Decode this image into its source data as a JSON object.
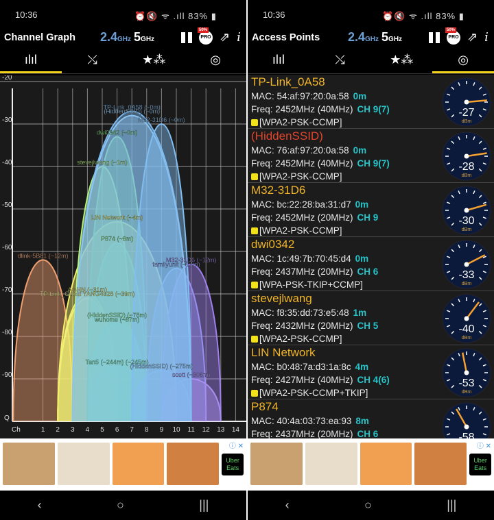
{
  "status": {
    "time": "10:36",
    "icons": "⏰🔇 ᯤ .ıll",
    "battery": "83%"
  },
  "bands": {
    "b24": "2.4",
    "b5": "5",
    "unit": "GHz"
  },
  "pro_badge": "PRO",
  "pro_tag": "50%",
  "tabs": [
    {
      "icon": "bar-chart-icon",
      "glyph": "ılıl"
    },
    {
      "icon": "time-graph-icon",
      "glyph": "⤯"
    },
    {
      "icon": "rating-stars-icon",
      "glyph": "★⁂"
    },
    {
      "icon": "access-point-icon",
      "glyph": "◎"
    }
  ],
  "left": {
    "title": "Channel Graph",
    "active_tab": 0
  },
  "right": {
    "title": "Access Points",
    "active_tab": 3
  },
  "chart_data": {
    "type": "area",
    "ylabel_bottom": "Q",
    "xlabel": "Ch",
    "ylim": [
      -100,
      -20
    ],
    "yticks": [
      -20,
      -30,
      -40,
      -50,
      -60,
      -70,
      -80,
      -90
    ],
    "xticks": [
      1,
      2,
      3,
      4,
      5,
      6,
      7,
      8,
      9,
      10,
      11,
      12,
      13,
      14
    ],
    "grid": true,
    "series": [
      {
        "name": "dlink-5B81 (~12m)",
        "channel": 1,
        "width_mhz": 20,
        "dbm": -62,
        "color": "#f0a070"
      },
      {
        "name": "AGHN (~31m)",
        "channel": 4,
        "width_mhz": 20,
        "dbm": -70,
        "color": "#f5f07a"
      },
      {
        "name": "TP-Link_Guest YANG4928 (~39m)",
        "channel": 4,
        "width_mhz": 20,
        "dbm": -71,
        "color": "#e8f080"
      },
      {
        "name": "LIN Network (~4m)",
        "channel": 6,
        "width_mhz": 40,
        "dbm": -53,
        "color": "#f3f06a"
      },
      {
        "name": "stevejlwang (~1m)",
        "channel": 5,
        "width_mhz": 20,
        "dbm": -40,
        "color": "#b4f07a"
      },
      {
        "name": "P874 (~8m)",
        "channel": 6,
        "width_mhz": 20,
        "dbm": -58,
        "color": "#8af08a"
      },
      {
        "name": "(HiddenSSID) (~78m)",
        "channel": 6,
        "width_mhz": 20,
        "dbm": -76,
        "color": "#90f0a0"
      },
      {
        "name": "wuhome (~87m)",
        "channel": 6,
        "width_mhz": 20,
        "dbm": -77,
        "color": "#80f0a8"
      },
      {
        "name": "Tan5 (~244m) (~245m)",
        "channel": 6,
        "width_mhz": 20,
        "dbm": -87,
        "color": "#80f0c0"
      },
      {
        "name": "dwi0342 (~0m)",
        "channel": 6,
        "width_mhz": 20,
        "dbm": -33,
        "color": "#7ae07a"
      },
      {
        "name": "(HiddenSSID) (~275m)",
        "channel": 9,
        "width_mhz": 20,
        "dbm": -88,
        "color": "#90c8f0"
      },
      {
        "name": "familyunit (~14m)",
        "channel": 10,
        "width_mhz": 20,
        "dbm": -64,
        "color": "#8c9cf0"
      },
      {
        "name": "M32-31D6 (~12m)",
        "channel": 11,
        "width_mhz": 20,
        "dbm": -63,
        "color": "#a080f0"
      },
      {
        "name": "scott (~306m)",
        "channel": 11,
        "width_mhz": 20,
        "dbm": -90,
        "color": "#a890f0"
      },
      {
        "name": "TP-Link_0A58 (~0m)",
        "channel": 7,
        "width_mhz": 40,
        "dbm": -27,
        "color": "#7ab8f0"
      },
      {
        "name": "(HiddenSSID) (~0m)",
        "channel": 7,
        "width_mhz": 40,
        "dbm": -28,
        "color": "#8cc4f0"
      },
      {
        "name": "M32-31D6 (~0m)",
        "channel": 9,
        "width_mhz": 20,
        "dbm": -30,
        "color": "#80bdf0"
      }
    ]
  },
  "access_points": [
    {
      "ssid": "TP-Link_0A58",
      "hidden": false,
      "mac": "MAC: 54:af:97:20:0a:58",
      "dist": "0m",
      "freq": "Freq: 2452MHz  (40MHz)",
      "ch": "CH 9(7)",
      "sec": "[WPA2-PSK-CCMP]",
      "dbm": -27
    },
    {
      "ssid": "(HiddenSSID)",
      "hidden": true,
      "mac": "MAC: 76:af:97:20:0a:58",
      "dist": "0m",
      "freq": "Freq: 2452MHz  (40MHz)",
      "ch": "CH 9(7)",
      "sec": "[WPA2-PSK-CCMP]",
      "dbm": -28
    },
    {
      "ssid": "M32-31D6",
      "hidden": false,
      "mac": "MAC: bc:22:28:ba:31:d7",
      "dist": "0m",
      "freq": "Freq: 2452MHz  (20MHz)",
      "ch": "CH 9",
      "sec": "[WPA2-PSK-CCMP]",
      "dbm": -30
    },
    {
      "ssid": "dwi0342",
      "hidden": false,
      "mac": "MAC: 1c:49:7b:70:45:d4",
      "dist": "0m",
      "freq": "Freq: 2437MHz  (20MHz)",
      "ch": "CH 6",
      "sec": "[WPA-PSK-TKIP+CCMP]",
      "dbm": -33
    },
    {
      "ssid": "stevejlwang",
      "hidden": false,
      "mac": "MAC: f8:35:dd:73:e5:48",
      "dist": "1m",
      "freq": "Freq: 2432MHz  (20MHz)",
      "ch": "CH 5",
      "sec": "[WPA2-PSK-CCMP]",
      "dbm": -40
    },
    {
      "ssid": "LIN Network",
      "hidden": false,
      "mac": "MAC: b0:48:7a:d3:1a:8c",
      "dist": "4m",
      "freq": "Freq: 2427MHz  (40MHz)",
      "ch": "CH 4(6)",
      "sec": "[WPA2-PSK-CCMP+TKIP]",
      "dbm": -53
    },
    {
      "ssid": "P874",
      "hidden": false,
      "mac": "MAC: 40:4a:03:73:ea:93",
      "dist": "8m",
      "freq": "Freq: 2437MHz  (20MHz)",
      "ch": "CH 6",
      "sec": "",
      "dbm": -58
    }
  ],
  "gauge_unit": "dBm",
  "ad": {
    "brand": "Uber Eats",
    "colors": [
      "#c9a070",
      "#e8dccb",
      "#f0a050",
      "#d08040"
    ]
  },
  "nav": {
    "back": "‹",
    "home": "○",
    "recent": "|||"
  }
}
